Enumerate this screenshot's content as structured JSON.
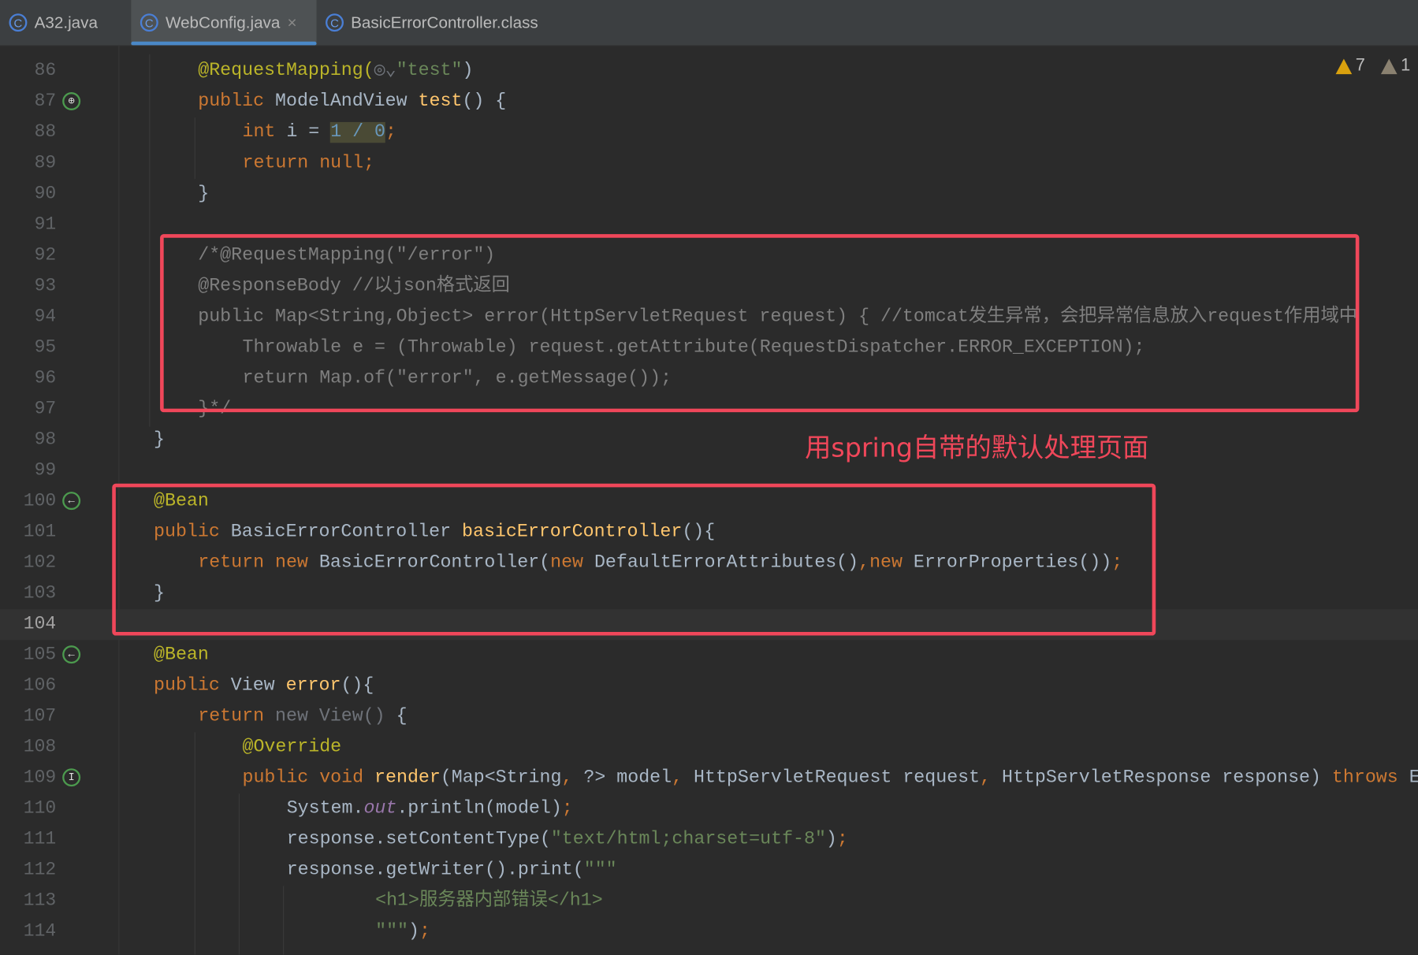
{
  "tabs": [
    {
      "label": "A32.java",
      "active": false
    },
    {
      "label": "WebConfig.java",
      "active": true,
      "close": "×"
    },
    {
      "label": "BasicErrorController.class",
      "active": false
    }
  ],
  "inspections": {
    "warnings": "7",
    "weak_warnings": "1",
    "warning_color": "#d9a10e"
  },
  "annotation": {
    "label": "用spring自带的默认处理页面",
    "color": "#f0475a"
  },
  "current_line": 104,
  "gutter_icons": {
    "87": "web-endpoint-icon",
    "100": "bean-icon",
    "105": "bean-icon",
    "109": "implements-method-icon"
  },
  "lines": [
    {
      "n": 86,
      "i": 1,
      "t": [
        [
          "@RequestMapping(",
          "ann"
        ],
        [
          "◎⌄",
          "dim"
        ],
        [
          "\"test\"",
          "str"
        ],
        [
          ")",
          "pl"
        ]
      ]
    },
    {
      "n": 87,
      "i": 1,
      "t": [
        [
          "public ",
          "kw"
        ],
        [
          "ModelAndView ",
          "pl"
        ],
        [
          "test",
          "fn"
        ],
        [
          "() {",
          "pl"
        ]
      ]
    },
    {
      "n": 88,
      "i": 2,
      "t": [
        [
          "int ",
          "kw"
        ],
        [
          "i = ",
          "pl"
        ],
        [
          "1 / 0",
          "num hl"
        ],
        [
          ";",
          "kw"
        ]
      ]
    },
    {
      "n": 89,
      "i": 2,
      "t": [
        [
          "return null;",
          "kw"
        ]
      ]
    },
    {
      "n": 90,
      "i": 1,
      "t": [
        [
          "}",
          "pl"
        ]
      ]
    },
    {
      "n": 91,
      "i": 0,
      "t": []
    },
    {
      "n": 92,
      "i": 1,
      "t": [
        [
          "/*@RequestMapping(\"/error\")",
          "cmt"
        ]
      ]
    },
    {
      "n": 93,
      "i": 1,
      "t": [
        [
          "@ResponseBody //以json格式返回",
          "cmt"
        ]
      ]
    },
    {
      "n": 94,
      "i": 1,
      "t": [
        [
          "public Map<String,Object> error(HttpServletRequest request) { //tomcat发生异常，会把异常信息放入request作用域中",
          "cmt"
        ]
      ]
    },
    {
      "n": 95,
      "i": 2,
      "t": [
        [
          "Throwable e = (Throwable) request.getAttribute(RequestDispatcher.ERROR_EXCEPTION);",
          "cmt"
        ]
      ]
    },
    {
      "n": 96,
      "i": 2,
      "t": [
        [
          "return Map.of(\"error\", e.getMessage());",
          "cmt"
        ]
      ]
    },
    {
      "n": 97,
      "i": 1,
      "t": [
        [
          "}*/",
          "cmt"
        ]
      ]
    },
    {
      "n": 98,
      "i": 0,
      "t": [
        [
          "}",
          "pl"
        ]
      ]
    },
    {
      "n": 99,
      "i": 0,
      "t": []
    },
    {
      "n": 100,
      "i": 0,
      "t": [
        [
          "@Bean",
          "ann"
        ]
      ]
    },
    {
      "n": 101,
      "i": 0,
      "t": [
        [
          "public ",
          "kw"
        ],
        [
          "BasicErrorController ",
          "pl"
        ],
        [
          "basicErrorController",
          "fn"
        ],
        [
          "(){",
          "pl"
        ]
      ]
    },
    {
      "n": 102,
      "i": 1,
      "t": [
        [
          "return new ",
          "kw"
        ],
        [
          "BasicErrorController(",
          "pl"
        ],
        [
          "new ",
          "kw"
        ],
        [
          "DefaultErrorAttributes()",
          "pl"
        ],
        [
          ",",
          "kw"
        ],
        [
          "new ",
          "kw"
        ],
        [
          "ErrorProperties())",
          "pl"
        ],
        [
          ";",
          "kw"
        ]
      ]
    },
    {
      "n": 103,
      "i": 0,
      "t": [
        [
          "}",
          "pl"
        ]
      ]
    },
    {
      "n": 104,
      "i": 0,
      "t": []
    },
    {
      "n": 105,
      "i": 0,
      "t": [
        [
          "@Bean",
          "ann"
        ]
      ]
    },
    {
      "n": 106,
      "i": 0,
      "t": [
        [
          "public ",
          "kw"
        ],
        [
          "View ",
          "pl"
        ],
        [
          "error",
          "fn"
        ],
        [
          "(){",
          "pl"
        ]
      ]
    },
    {
      "n": 107,
      "i": 1,
      "t": [
        [
          "return ",
          "kw"
        ],
        [
          "new View() ",
          "dim"
        ],
        [
          "{",
          "pl"
        ]
      ]
    },
    {
      "n": 108,
      "i": 2,
      "t": [
        [
          "@Override",
          "ann"
        ]
      ]
    },
    {
      "n": 109,
      "i": 2,
      "t": [
        [
          "public void ",
          "kw"
        ],
        [
          "render",
          "fn"
        ],
        [
          "(Map<String",
          "pl"
        ],
        [
          ", ",
          "kw"
        ],
        [
          "?> model",
          "pl"
        ],
        [
          ", ",
          "kw"
        ],
        [
          "HttpServletRequest request",
          "pl"
        ],
        [
          ", ",
          "kw"
        ],
        [
          "HttpServletResponse response) ",
          "pl"
        ],
        [
          "throws ",
          "kw"
        ],
        [
          "E",
          "pl"
        ]
      ]
    },
    {
      "n": 110,
      "i": 3,
      "t": [
        [
          "System.",
          "pl"
        ],
        [
          "out",
          "it"
        ],
        [
          ".println(model)",
          "pl"
        ],
        [
          ";",
          "kw"
        ]
      ]
    },
    {
      "n": 111,
      "i": 3,
      "t": [
        [
          "response.setContentType(",
          "pl"
        ],
        [
          "\"text/html;charset=utf-8\"",
          "str"
        ],
        [
          ")",
          "pl"
        ],
        [
          ";",
          "kw"
        ]
      ]
    },
    {
      "n": 112,
      "i": 3,
      "t": [
        [
          "response.getWriter().print(",
          "pl"
        ],
        [
          "\"\"\"",
          "str"
        ]
      ]
    },
    {
      "n": 113,
      "i": 5,
      "t": [
        [
          "<h1>服务器内部错误</h1>",
          "str"
        ]
      ]
    },
    {
      "n": 114,
      "i": 5,
      "t": [
        [
          "\"\"\"",
          "str"
        ],
        [
          ")",
          "pl"
        ],
        [
          ";",
          "kw"
        ]
      ]
    }
  ]
}
